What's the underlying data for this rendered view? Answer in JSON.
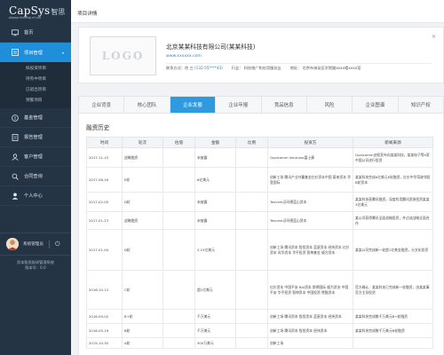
{
  "brand": {
    "name": "CapSys",
    "cn": "智思",
    "tagline": "Always thinking of you"
  },
  "nav": {
    "items": [
      {
        "label": "首页",
        "icon": "monitor-icon"
      },
      {
        "label": "项目管理",
        "icon": "project-icon",
        "caret": "▾"
      },
      {
        "label": "基金管理",
        "icon": "fund-icon"
      },
      {
        "label": "报告管理",
        "icon": "report-icon"
      },
      {
        "label": "客户管理",
        "icon": "customer-icon"
      },
      {
        "label": "合同查询",
        "icon": "contract-icon"
      },
      {
        "label": "个人中心",
        "icon": "person-icon"
      }
    ],
    "sub": [
      "拟投资项目",
      "持有中项目",
      "已退出项目",
      "预警项目"
    ]
  },
  "user": {
    "name": "系统管理员",
    "power": "⏻"
  },
  "copyright": [
    "资本智思投研管理系统",
    "版本号：0.0"
  ],
  "breadcrumb": "项目详情",
  "company": {
    "logo_text": "LOGO",
    "name": "北京某某科技有限公司(某某科技)",
    "url": "www.xxxxxx.com",
    "contact_label": "联系方式：",
    "contact_name": "徐 三",
    "contact_phone": "(132-55****43)",
    "industry": "行业：  科技推广和应用服务业",
    "address": "地址：  北京市海淀区学院路xxxx楼xxxx室",
    "close": "×"
  },
  "tabs": [
    "企业背景",
    "核心团队",
    "企业发展",
    "企业年报",
    "竞品信息",
    "风险",
    "企业图谱",
    "知识产权"
  ],
  "active_tab": 2,
  "section_title": "融资历史",
  "table": {
    "headers": [
      "时间",
      "轮次",
      "估值",
      "金额",
      "比例",
      "投资方",
      "新闻来源"
    ],
    "rows": [
      [
        "2017-11-15",
        "战略融资",
        "",
        "未披露",
        "",
        "Qualcomm Ventures富士康",
        "Qualcomm创投宣布向某某科技，某某电子等9家中国公司进行投资"
      ],
      [
        "2017-06-16",
        "E轮",
        "",
        "6亿美元",
        "",
        "创新工场 腾讯产业共赢基金红杉资本中国 蔚来资本 华登国际",
        "某某科技完成6亿美元E轮融资，红杉中华驾驶领投B轮资本"
      ],
      [
        "2017-02-05",
        "D轮",
        "",
        "未披露",
        "",
        "Tencent沃玛德蓝山资本",
        "某某科技获腾讯融资，深度利用腾讯资源投资某某3亿美元"
      ],
      [
        "2017-01-23",
        "战略融资",
        "",
        "未披露",
        "",
        "Tencent沃玛德蓝山资本",
        "某公司获得腾讯全面战略投资，并达成战略全面合作"
      ],
      [
        "2017-01-04",
        "D轮",
        "",
        "2.15亿美元",
        "",
        "创新工场 腾讯资本 智投资本 蓝星资本 经纬资本 红杉资本 风华资本 华平投资 智坤基金 顺为资本",
        "某某公司完成新一轮超1亿美金融资，分文化投资"
      ],
      [
        "2016-10-13",
        "C轮",
        "",
        "超1亿美元",
        "",
        "红杉资本 中国平安 BAI资本 斯德国际 顺为资本 中国平安 华平投资 智坤资本 中国投资 熊猫资本",
        "官方确认：某某科技已完成新一轮融资，由某某事官方主导投资"
      ],
      [
        "2016-09-02",
        "B+轮",
        "",
        "千万美元",
        "",
        "创新工场 腾讯资本 智投资本 蓝星资本 经纬资本",
        "某某科技完成数千万美元B+轮融资"
      ],
      [
        "2016-05-19",
        "B轮",
        "",
        "千万美元",
        "",
        "创新工场 腾讯资本 智投资本 经纬资本",
        "某某科技完成数千万美元B轮融资"
      ],
      [
        "2015-10-30",
        "A轮",
        "",
        "300万美元",
        "",
        "创新工场",
        ""
      ]
    ]
  },
  "colors": {
    "sidebar": "#253444",
    "accent": "#1e8fd8",
    "tab_active": "#2f9ae0",
    "link": "#2d87d0"
  }
}
